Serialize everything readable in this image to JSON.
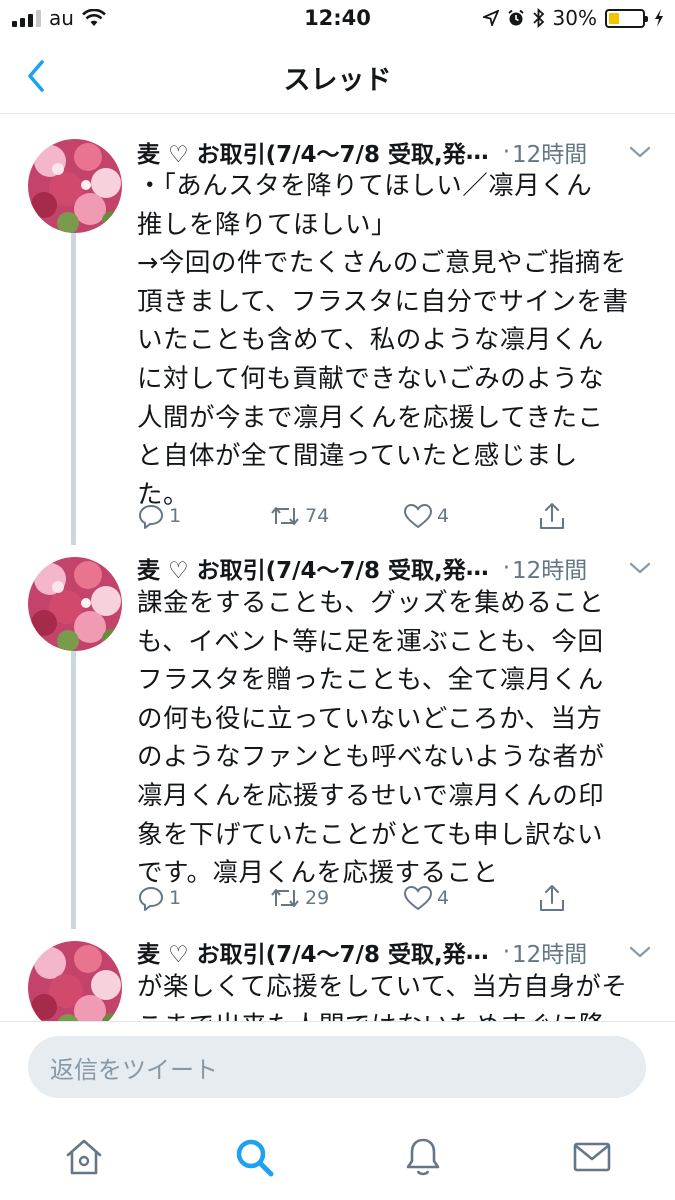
{
  "status_bar": {
    "carrier": "au",
    "time": "12:40",
    "battery_text": "30%",
    "battery_level": 0.3
  },
  "header": {
    "title": "スレッド"
  },
  "tweets": [
    {
      "author": "麦 ♡ お取引(7/4〜7/8 受取,発",
      "ellipsis": "…",
      "dot": "·",
      "time": "12時間",
      "text_lines": [
        "・「あんスタを降りてほしい／凛月くん",
        "推しを降りてほしい」",
        "→今回の件でたくさんのご意見やご指摘を",
        "頂きまして、フラスタに自分でサインを書",
        "いたことも含めて、私のような凛月くん",
        "に対して何も貢献できないごみのような",
        "人間が今まで凛月くんを応援してきたこ",
        "と自体が全て間違っていたと感じまし",
        "た。"
      ],
      "replies": "1",
      "retweets": "74",
      "likes": "4"
    },
    {
      "author": "麦 ♡ お取引(7/4〜7/8 受取,発",
      "ellipsis": "…",
      "dot": "·",
      "time": "12時間",
      "text_lines": [
        "課金をすることも、グッズを集めること",
        "も、イベント等に足を運ぶことも、今回",
        "フラスタを贈ったことも、全て凛月くん",
        "の何も役に立っていないどころか、当方",
        "のようなファンとも呼べないような者が",
        "凛月くんを応援するせいで凛月くんの印",
        "象を下げていたことがとても申し訳ない",
        "です。凛月くんを応援すること"
      ],
      "replies": "1",
      "retweets": "29",
      "likes": "4"
    },
    {
      "author": "麦 ♡ お取引(7/4〜7/8 受取,発",
      "ellipsis": "…",
      "dot": "·",
      "time": "12時間",
      "text_lines": [
        "が楽しくて応援をしていて、当方自身がそ",
        "こまで出来た人間ではないためすぐに降"
      ]
    }
  ],
  "reply_bar": {
    "placeholder": "返信をツイート"
  },
  "tabs": [
    "home-icon",
    "search-icon",
    "notifications-icon",
    "messages-icon"
  ],
  "colors": {
    "accent": "#1da1f2",
    "secondary_text": "#657786",
    "thread_line": "#ccd6dd",
    "battery": "#f5c400"
  }
}
